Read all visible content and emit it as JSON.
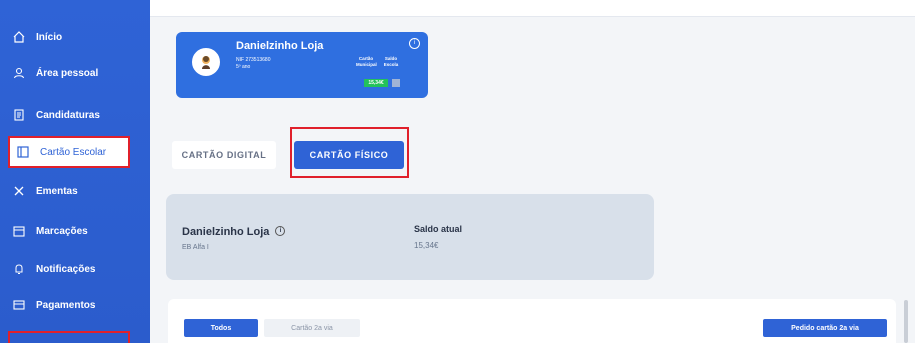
{
  "sidebar": {
    "items": [
      {
        "label": "Início",
        "icon": "home-icon"
      },
      {
        "label": "Área pessoal",
        "icon": "user-icon"
      },
      {
        "label": "Candidaturas",
        "icon": "document-icon"
      },
      {
        "label": "Cartão Escolar",
        "icon": "card-icon"
      },
      {
        "label": "Ementas",
        "icon": "utensils-icon"
      },
      {
        "label": "Marcações",
        "icon": "calendar-icon"
      },
      {
        "label": "Notificações",
        "icon": "bell-icon"
      },
      {
        "label": "Pagamentos",
        "icon": "payment-icon"
      }
    ]
  },
  "profile": {
    "name": "Danielzinho Loja",
    "nif": "NIF 273513680",
    "year": "5º ano",
    "card_label": "Cartão Municipal",
    "balance_label": "Saldo Escola",
    "card_balance": "15,34€"
  },
  "tabs": {
    "digital": "CARTÃO DIGITAL",
    "fisico": "CARTÃO FÍSICO"
  },
  "balance": {
    "name": "Danielzinho Loja",
    "school": "EB Alfa I",
    "label": "Saldo atual",
    "value": "15,34€"
  },
  "filters": {
    "todos": "Todos",
    "segunda_via": "Cartão 2a via",
    "pedido": "Pedido cartão 2a via"
  },
  "colors": {
    "primary": "#2f63d6",
    "highlight": "#e0202b",
    "success": "#23c25b"
  }
}
